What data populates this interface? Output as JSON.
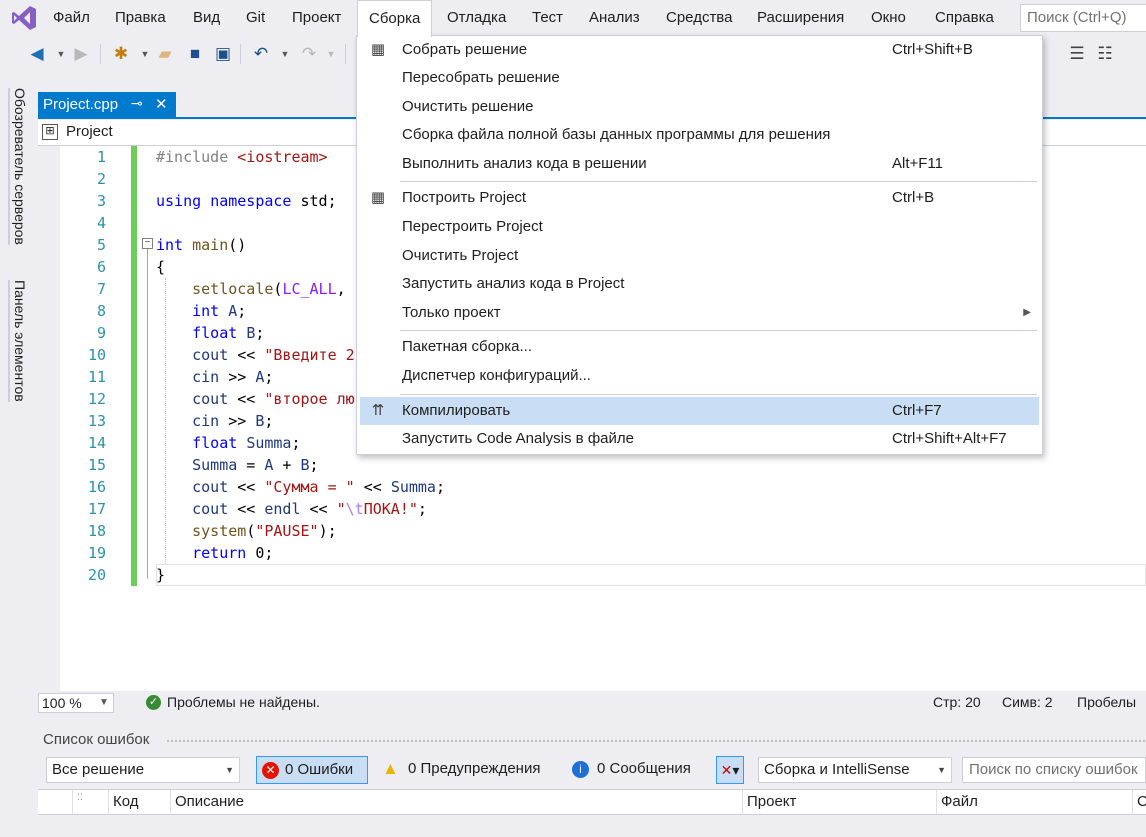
{
  "menubar": {
    "items": [
      "Файл",
      "Правка",
      "Вид",
      "Git",
      "Проект",
      "Сборка",
      "Отладка",
      "Тест",
      "Анализ",
      "Средства",
      "Расширения",
      "Окно",
      "Справка"
    ],
    "search_placeholder": "Поиск (Ctrl+Q)"
  },
  "sidebar": {
    "server_explorer": "Обозреватель серверов",
    "toolbox": "Панель элементов"
  },
  "document": {
    "tab_label": "Project.cpp",
    "pin_glyph": "⊸",
    "close_glyph": "✕",
    "nav_project": "Project"
  },
  "editor": {
    "line_numbers": [
      "1",
      "2",
      "3",
      "4",
      "5",
      "6",
      "7",
      "8",
      "9",
      "10",
      "11",
      "12",
      "13",
      "14",
      "15",
      "16",
      "17",
      "18",
      "19",
      "20"
    ],
    "lines": [
      "#include <iostream>",
      "",
      "using namespace std;",
      "",
      "int main()",
      "{",
      "    setlocale(LC_ALL,",
      "    int A;",
      "    float B;",
      "    cout << \"Введите 2",
      "    cin >> A;",
      "    cout << \"второе лю",
      "    cin >> B;",
      "    float Summa;",
      "    Summa = A + B;",
      "    cout << \"Сумма = \" << Summa;",
      "    cout << endl << \"\\tПОКА!\";",
      "    system(\"PAUSE\");",
      "    return 0;",
      "}"
    ]
  },
  "status": {
    "zoom": "100 %",
    "issues": "Проблемы не найдены.",
    "line": "Стр: 20",
    "col": "Симв: 2",
    "whitespace": "Пробелы"
  },
  "error_list": {
    "title": "Список ошибок",
    "scope": "Все решение",
    "errors": "0 Ошибки",
    "warnings": "0 Предупреждения",
    "messages": "0 Сообщения",
    "source": "Сборка и IntelliSense",
    "search_placeholder": "Поиск по списку ошибок",
    "columns": [
      "Код",
      "Описание",
      "Проект",
      "Файл"
    ]
  },
  "build_menu": {
    "items": [
      {
        "label": "Собрать решение",
        "shortcut": "Ctrl+Shift+B",
        "icon": "build-solution-icon"
      },
      {
        "label": "Пересобрать решение",
        "shortcut": ""
      },
      {
        "label": "Очистить решение",
        "shortcut": ""
      },
      {
        "label": "Сборка файла полной базы данных программы для решения",
        "shortcut": ""
      },
      {
        "label": "Выполнить анализ кода в решении",
        "shortcut": "Alt+F11"
      },
      {
        "label": "Построить Project",
        "shortcut": "Ctrl+B",
        "icon": "build-project-icon"
      },
      {
        "label": "Перестроить Project",
        "shortcut": ""
      },
      {
        "label": "Очистить Project",
        "shortcut": ""
      },
      {
        "label": "Запустить анализ кода в Project",
        "shortcut": ""
      },
      {
        "label": "Только проект",
        "shortcut": "",
        "submenu": true
      },
      {
        "label": "Пакетная сборка...",
        "shortcut": ""
      },
      {
        "label": "Диспетчер конфигураций...",
        "shortcut": ""
      },
      {
        "label": "Компилировать",
        "shortcut": "Ctrl+F7",
        "icon": "compile-icon",
        "highlighted": true
      },
      {
        "label": "Запустить Code Analysis в файле",
        "shortcut": "Ctrl+Shift+Alt+F7"
      }
    ]
  },
  "colors": {
    "accent": "#007acc",
    "highlight": "#c9def5",
    "changebar": "#6cce5a"
  }
}
